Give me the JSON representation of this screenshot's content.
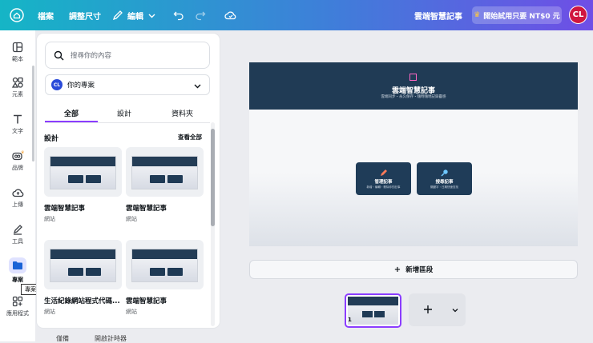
{
  "topbar": {
    "menu": [
      "檔案",
      "調整尺寸"
    ],
    "edit_label": "編輯",
    "doc_title": "雲端智慧記事",
    "upgrade_label": "開始試用只要 NT$0 元",
    "user_initials": "CL"
  },
  "rail": {
    "items": [
      {
        "label": "範本",
        "icon": "template-icon"
      },
      {
        "label": "元素",
        "icon": "elements-icon"
      },
      {
        "label": "文字",
        "icon": "text-icon"
      },
      {
        "label": "品牌",
        "icon": "brand-icon"
      },
      {
        "label": "上傳",
        "icon": "upload-icon"
      },
      {
        "label": "工具",
        "icon": "tools-icon"
      },
      {
        "label": "專案",
        "icon": "folder-icon"
      },
      {
        "label": "應用程式",
        "icon": "apps-icon"
      }
    ],
    "tooltip": "專案"
  },
  "panel": {
    "search_placeholder": "搜尋你的內容",
    "project_select": {
      "initials": "CL",
      "label": "你的專案"
    },
    "tabs": [
      "全部",
      "設計",
      "資料夾"
    ],
    "section_title": "設計",
    "see_all": "查看全部",
    "designs": [
      {
        "title": "雲端智慧記事",
        "type": "網站"
      },
      {
        "title": "雲端智慧記事",
        "type": "網站"
      },
      {
        "title": "生活紀錄網站程式代碼...",
        "type": "網站"
      },
      {
        "title": "雲端智慧記事",
        "type": "網站"
      }
    ],
    "footer_items": [
      "僅備",
      "開啟計時器"
    ]
  },
  "canvas": {
    "hero_title": "雲端智慧記事",
    "hero_subtitle": "雲端同步・永久保存・隨時隨地記錄靈感",
    "cards": [
      {
        "title": "管理記事",
        "desc": "新增・編輯・刪除你的記事"
      },
      {
        "title": "搜尋記事",
        "desc": "關鍵字・日期快速查找"
      }
    ]
  },
  "add_section_label": "新增區段",
  "pages": {
    "current": "1"
  },
  "colors": {
    "accent": "#8b3dff",
    "hero": "#203b55",
    "avatar": "#d0163f"
  }
}
